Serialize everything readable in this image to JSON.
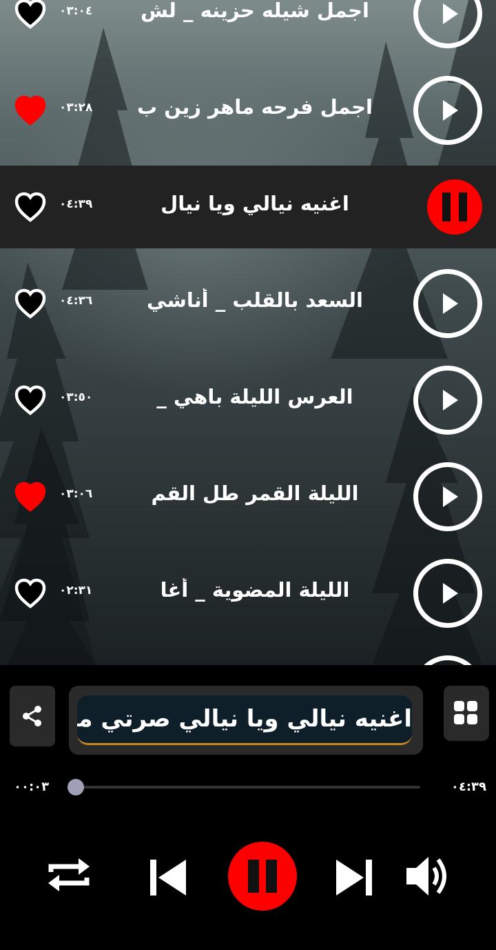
{
  "songs": [
    {
      "title": "اجمل شيله حزينه _ لش",
      "duration": "٠٣:٠٤",
      "favorite": false,
      "playing": false
    },
    {
      "title": "اجمل فرحه ماهر زين ب",
      "duration": "٠٣:٢٨",
      "favorite": true,
      "playing": false
    },
    {
      "title": "اغنيه نيالي ويا نيال",
      "duration": "٠٤:٣٩",
      "favorite": false,
      "playing": true
    },
    {
      "title": "السعد بالقلب _ أناشي",
      "duration": "٠٤:٣٦",
      "favorite": false,
      "playing": false
    },
    {
      "title": "العرس الليلة باهي _",
      "duration": "٠٣:٥٠",
      "favorite": false,
      "playing": false
    },
    {
      "title": "الليلة القمر طل القم",
      "duration": "٠٣:٠٦",
      "favorite": true,
      "playing": false
    },
    {
      "title": "الليلة المضوية _ أغا",
      "duration": "٠٢:٣١",
      "favorite": false,
      "playing": false
    }
  ],
  "player": {
    "now_playing": "اغنيه نيالي ويا نيالي صرتي مرتي",
    "elapsed": "٠٠:٠٣",
    "total": "٠٤:٣٩",
    "progress_fraction": 0.0,
    "state": "playing"
  },
  "icons": {
    "heart": "heart-icon",
    "play": "play-icon",
    "pause": "pause-icon",
    "share": "share-icon",
    "grid": "grid-icon",
    "repeat": "repeat-icon",
    "previous": "skip-previous-icon",
    "next": "skip-next-icon",
    "volume": "volume-icon"
  },
  "colors": {
    "accent": "#ff0000",
    "favorite": "#ff0000",
    "active_row": "#222222",
    "marquee_underline": "#c88a1c"
  }
}
